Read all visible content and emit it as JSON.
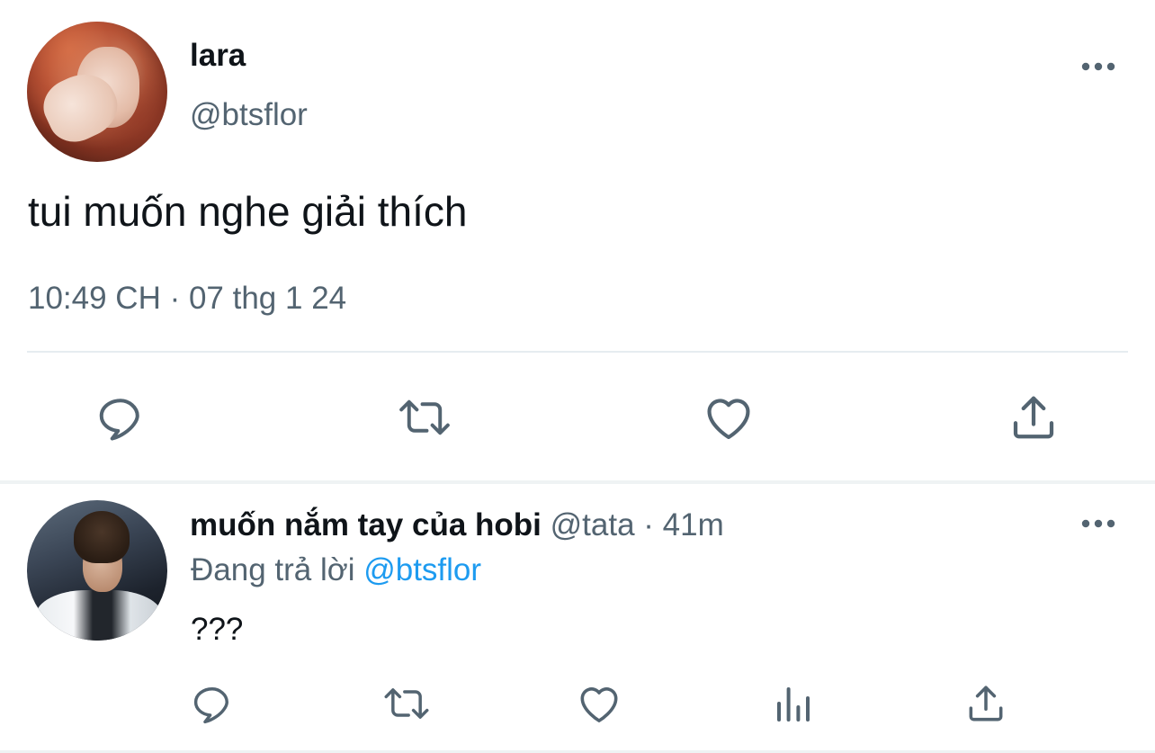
{
  "main_tweet": {
    "display_name": "lara",
    "handle": "@btsflor",
    "text": "tui muốn nghe giải thích",
    "timestamp": "10:49 CH · 07 thg 1 24",
    "more_icon": "more-horizontal-icon",
    "actions": [
      {
        "name": "reply",
        "icon": "comment-icon"
      },
      {
        "name": "retweet",
        "icon": "retweet-icon"
      },
      {
        "name": "like",
        "icon": "heart-icon"
      },
      {
        "name": "share",
        "icon": "share-icon"
      }
    ]
  },
  "reply_tweet": {
    "display_name": "muốn nắm tay của hobi",
    "handle": "@tata",
    "separator": " · ",
    "time_ago": "41m",
    "replying_prefix": "Đang trả lời ",
    "replying_to": "@btsflor",
    "text": "???",
    "more_icon": "more-horizontal-icon",
    "actions": [
      {
        "name": "reply",
        "icon": "comment-icon"
      },
      {
        "name": "retweet",
        "icon": "retweet-icon"
      },
      {
        "name": "like",
        "icon": "heart-icon"
      },
      {
        "name": "views",
        "icon": "analytics-icon"
      },
      {
        "name": "share",
        "icon": "share-icon"
      }
    ]
  },
  "colors": {
    "text_primary": "#0f1419",
    "text_secondary": "#536471",
    "link": "#1d9bf0",
    "divider": "#e6ecf0"
  }
}
